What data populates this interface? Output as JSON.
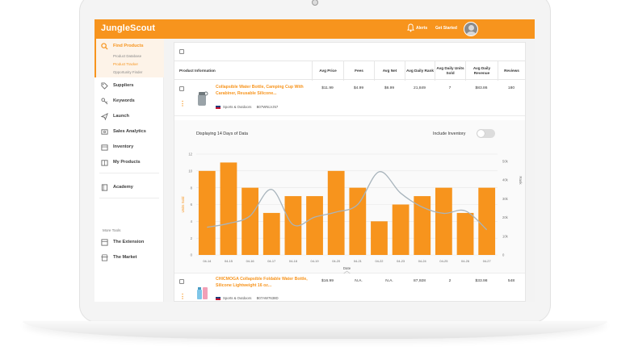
{
  "app": {
    "brand": "JungleScout"
  },
  "topbar": {
    "alerts_label": "Alerts",
    "get_started_label": "Get Started"
  },
  "sidebar": {
    "find_products": {
      "label": "Find Products",
      "sub_items": [
        "Product Database",
        "Product Tracker",
        "Opportunity Finder"
      ]
    },
    "items": [
      {
        "label": "Suppliers",
        "icon": "tag-icon"
      },
      {
        "label": "Keywords",
        "icon": "key-icon"
      },
      {
        "label": "Launch",
        "icon": "paper-plane-icon"
      },
      {
        "label": "Sales Analytics",
        "icon": "dollar-icon"
      },
      {
        "label": "Inventory",
        "icon": "box-icon"
      },
      {
        "label": "My Products",
        "icon": "box-icon"
      },
      {
        "label": "Academy",
        "icon": "book-icon"
      }
    ],
    "more_tools_label": "More Tools",
    "tools": [
      {
        "label": "The Extension",
        "icon": "extension-icon"
      },
      {
        "label": "The Market",
        "icon": "store-icon"
      }
    ]
  },
  "table": {
    "headers": [
      "Product Information",
      "Avg Price",
      "Fees",
      "Avg Net",
      "Avg Daily Rank",
      "Avg Daily Units Sold",
      "Avg Daily Revenue",
      "Reviews"
    ],
    "rows": [
      {
        "title": "Collapsible Water Bottle, Camping Cup With Carabiner, Reusable Silicone...",
        "category": "Sports & Outdoors",
        "asin": "B07WNLVJ57",
        "values": [
          "$11.99",
          "$4.99",
          "$6.99",
          "21,849",
          "7",
          "$83.86",
          "180"
        ]
      },
      {
        "title": "CHICMOGA Collapsible Foldable Water Bottle, Silicone Lightweight 16 oz...",
        "category": "Sports & Outdoors",
        "asin": "B07AW7638D",
        "values": [
          "$16.99",
          "N.A.",
          "N.A.",
          "87,928",
          "2",
          "$33.98",
          "548"
        ]
      }
    ]
  },
  "chart_panel": {
    "days_label": "Displaying 14 Days of Data",
    "inventory_label": "Include Inventory",
    "inventory_on": false
  },
  "chart_data": {
    "type": "bar",
    "categories": [
      "04-14",
      "04-15",
      "04-16",
      "04-17",
      "04-18",
      "04-19",
      "04-20",
      "04-21",
      "04-22",
      "04-23",
      "04-24",
      "04-25",
      "04-26",
      "04-27"
    ],
    "series": [
      {
        "name": "Units Sold",
        "type": "bar",
        "axis": "left",
        "values": [
          10,
          11,
          8,
          5,
          7,
          7,
          10,
          8,
          4,
          6,
          7,
          8,
          5,
          8
        ]
      },
      {
        "name": "Rank",
        "type": "line",
        "axis": "right",
        "values": [
          11000,
          12500,
          15500,
          26000,
          12000,
          15000,
          17000,
          20000,
          33000,
          24500,
          19000,
          16500,
          17500,
          10000
        ]
      }
    ],
    "xlabel": "Date",
    "ylabel": "Units Sold",
    "y2label": "Rank",
    "ylim": [
      0,
      12
    ],
    "yticks": [
      0,
      2,
      4,
      6,
      8,
      10,
      12
    ],
    "y2lim": [
      0,
      40000
    ],
    "y2ticks": [
      "0",
      "10k",
      "20k",
      "30k",
      "40k",
      "50k"
    ],
    "colors": {
      "bar": "#f7941d",
      "line": "#a8b4bc"
    },
    "grid": true
  }
}
